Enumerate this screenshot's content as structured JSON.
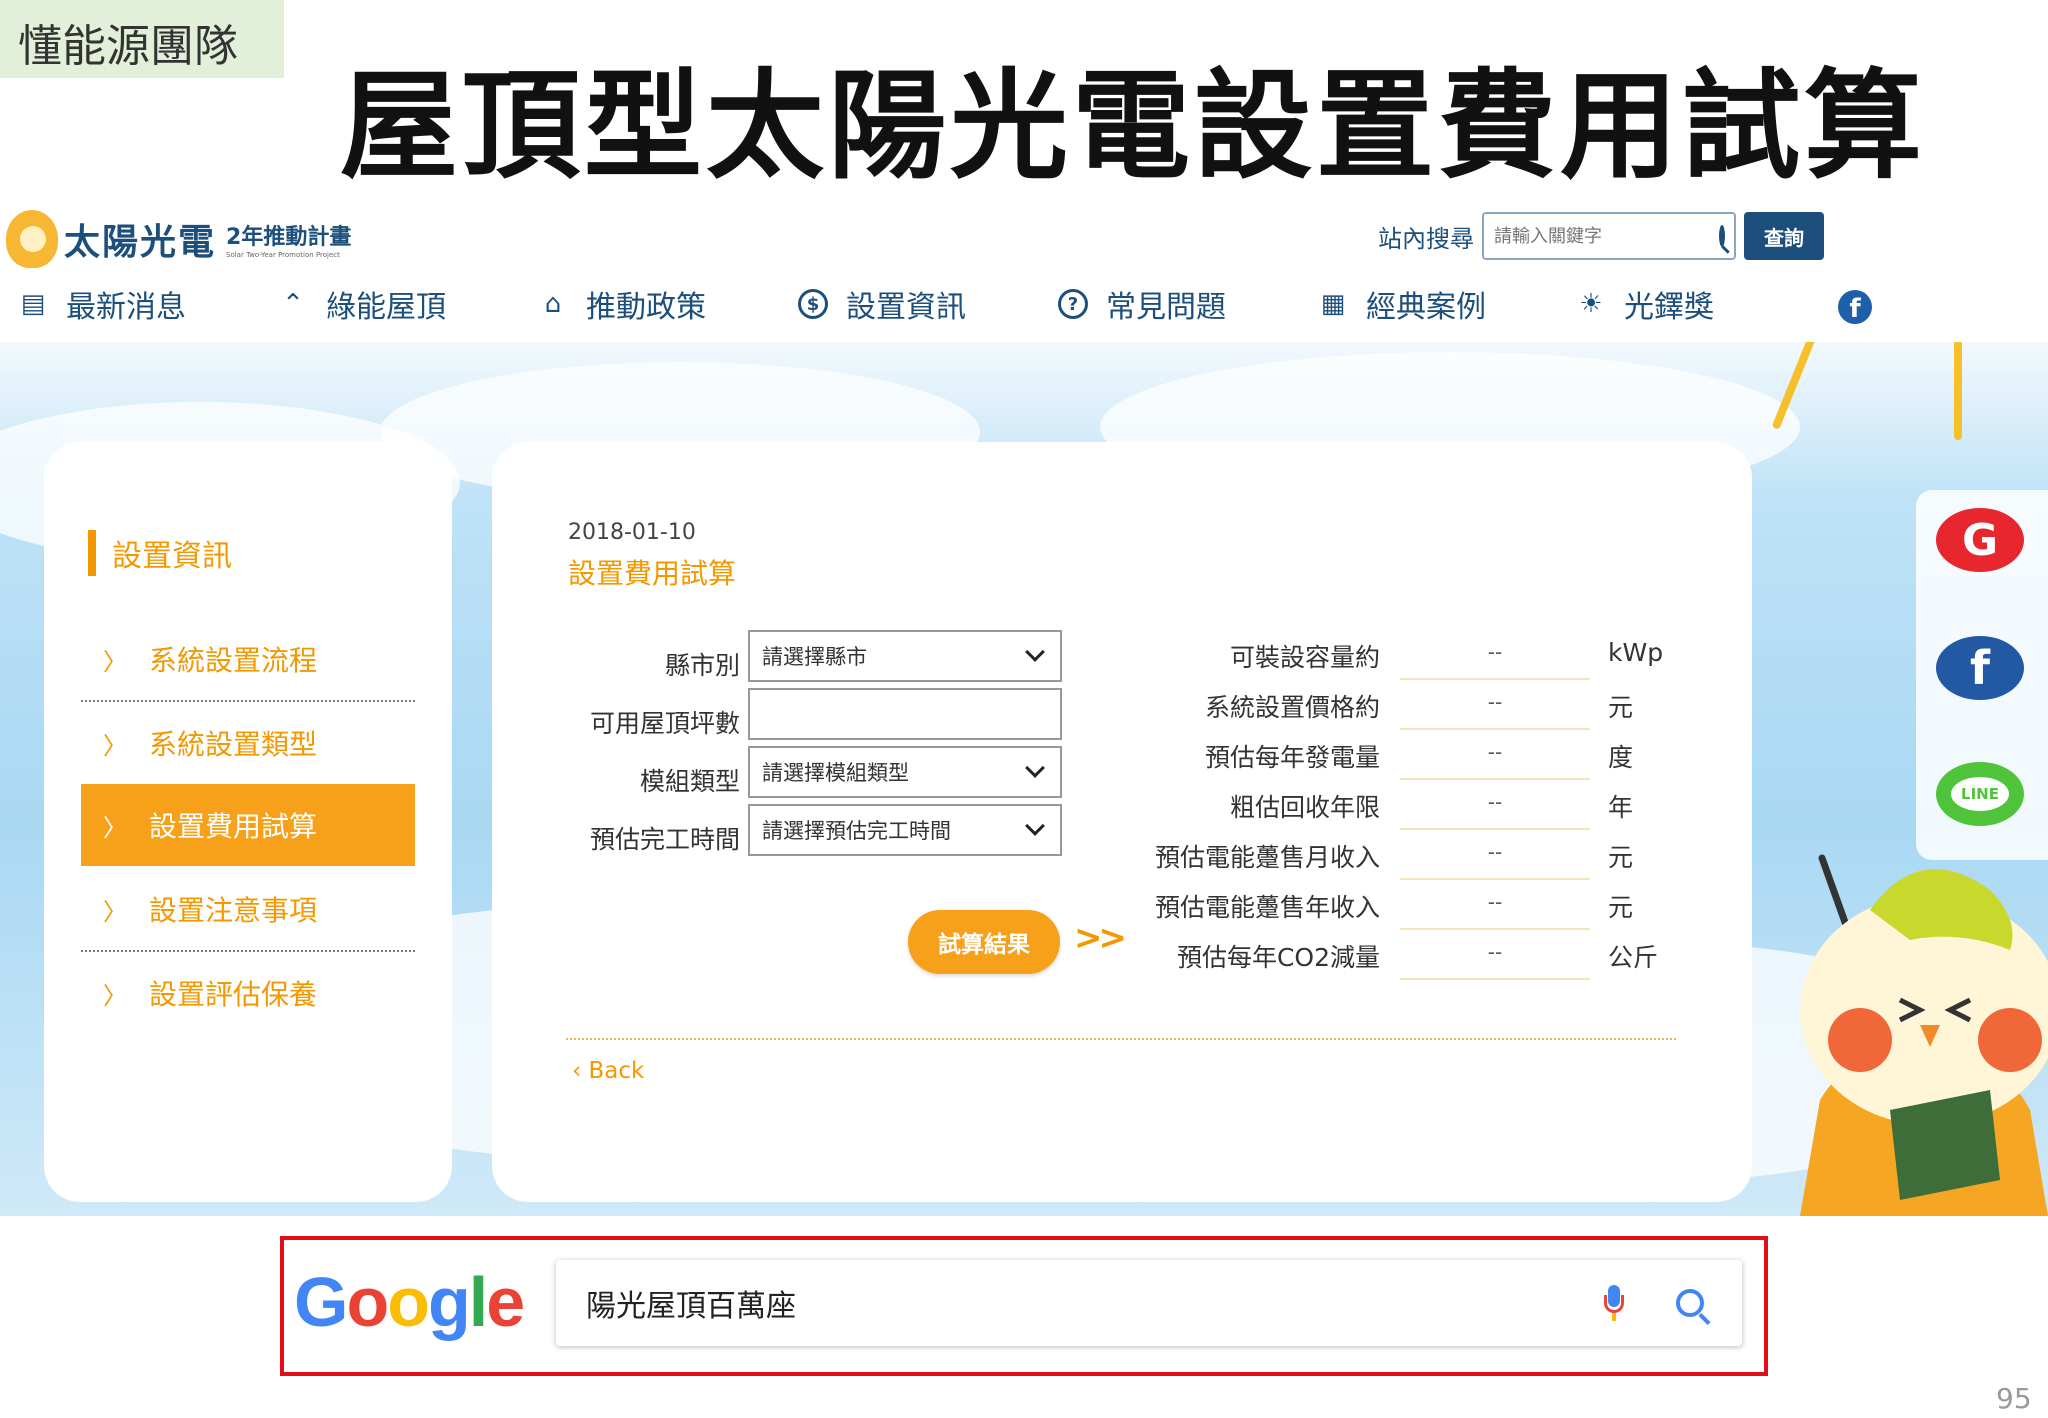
{
  "slide": {
    "team_tag": "懂能源團隊",
    "title": "屋頂型太陽光電設置費用試算",
    "page_number": "95"
  },
  "site": {
    "logo_text": "太陽光電",
    "logo_sub": "2年推動計畫",
    "logo_sub_en": "Solar Two-Year Promotion Project",
    "search_label": "站內搜尋",
    "search_placeholder": "請輸入關鍵字",
    "search_button": "查詢",
    "nav": [
      {
        "label": "最新消息",
        "icon": "news-icon"
      },
      {
        "label": "綠能屋頂",
        "icon": "rooftop-icon"
      },
      {
        "label": "推動政策",
        "icon": "government-icon"
      },
      {
        "label": "設置資訊",
        "icon": "dollar-icon"
      },
      {
        "label": "常見問題",
        "icon": "question-icon"
      },
      {
        "label": "經典案例",
        "icon": "grid-icon"
      },
      {
        "label": "光鐸獎",
        "icon": "award-icon"
      }
    ],
    "facebook": "f"
  },
  "sidebar": {
    "heading": "設置資訊",
    "items": [
      {
        "label": "系統設置流程"
      },
      {
        "label": "系統設置類型"
      },
      {
        "label": "設置費用試算",
        "active": true
      },
      {
        "label": "設置注意事項"
      },
      {
        "label": "設置評估保養"
      }
    ]
  },
  "article": {
    "date": "2018-01-10",
    "title": "設置費用試算"
  },
  "form": {
    "county_label": "縣市別",
    "county_value": "請選擇縣市",
    "roof_area_label": "可用屋頂坪數",
    "roof_area_value": "",
    "module_label": "模組類型",
    "module_value": "請選擇模組類型",
    "completion_label": "預估完工時間",
    "completion_value": "請選擇預估完工時間",
    "calc_button": "試算結果",
    "arrows": ">>"
  },
  "results": [
    {
      "label": "可裝設容量約",
      "value": "--",
      "unit": "kWp"
    },
    {
      "label": "系統設置價格約",
      "value": "--",
      "unit": "元"
    },
    {
      "label": "預估每年發電量",
      "value": "--",
      "unit": "度"
    },
    {
      "label": "粗估回收年限",
      "value": "--",
      "unit": "年"
    },
    {
      "label": "預估電能躉售月收入",
      "value": "--",
      "unit": "元"
    },
    {
      "label": "預估電能躉售年收入",
      "value": "--",
      "unit": "元"
    },
    {
      "label": "預估每年CO2減量",
      "value": "--",
      "unit": "公斤"
    }
  ],
  "back_link": "Back",
  "share": {
    "google": "G",
    "facebook": "f",
    "line": "LINE"
  },
  "google": {
    "logo": [
      {
        "ch": "G",
        "color": "#4285f4"
      },
      {
        "ch": "o",
        "color": "#ea4335"
      },
      {
        "ch": "o",
        "color": "#fbbc05"
      },
      {
        "ch": "g",
        "color": "#4285f4"
      },
      {
        "ch": "l",
        "color": "#34a853"
      },
      {
        "ch": "e",
        "color": "#ea4335"
      }
    ],
    "query": "陽光屋頂百萬座"
  },
  "colors": {
    "accent_orange": "#f39800",
    "brand_blue": "#1d4f7c",
    "highlight_red": "#e30d17"
  }
}
